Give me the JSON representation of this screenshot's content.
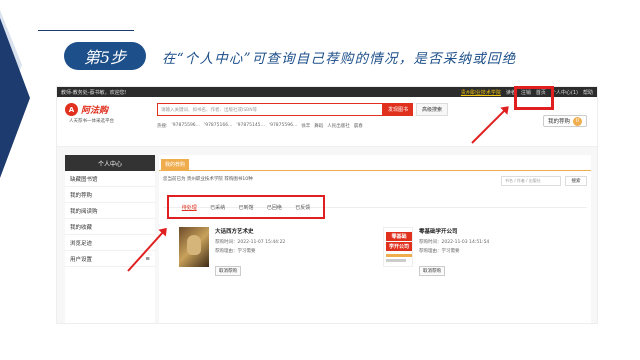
{
  "slide": {
    "step_label": "第5步",
    "step_desc": "在“个人中心”可查询自己荐购的情况，是否采纳或回绝"
  },
  "topbar": {
    "welcome": "教师-教务处-蔡书敏，欢迎您!",
    "school_link": "贵州职业技术学院",
    "items": [
      "读者",
      "注销",
      "首页",
      "个人中心(1)",
      "帮助"
    ]
  },
  "header": {
    "brand": "阿法购",
    "brand_mark": "A",
    "slogan": "人天荐书一体采选平台",
    "search_placeholder": "请输入关键词、如书名、作者、出版社或ISBN等",
    "search_button": "发现图书",
    "advanced_button": "高级搜索",
    "hot_label": "热搜:",
    "hot_terms": [
      "'97875596...",
      "'97875166...",
      "'97875145...",
      "'97875596...",
      "徐丰",
      "舞蹈",
      "人民出版社",
      "晨春"
    ],
    "my_purchase_label": "我的荐购",
    "my_purchase_count": "0"
  },
  "sidebar": {
    "title": "个人中心",
    "items": [
      {
        "label": "缺藏图书馆",
        "arrow": ""
      },
      {
        "label": "我的荐购",
        "arrow": ""
      },
      {
        "label": "我的阅读购",
        "arrow": ""
      },
      {
        "label": "我的收藏",
        "arrow": ""
      },
      {
        "label": "浏览足迹",
        "arrow": ""
      },
      {
        "label": "用户设置",
        "arrow": "≡"
      }
    ]
  },
  "main": {
    "tab": "我的荐购",
    "info": "您当前已为 贵州职业技术学院 荐购图书10种",
    "search_placeholder": "书名 / 作者 / 出版社",
    "search_button": "搜索",
    "status_tabs": [
      "待处理",
      "已采纳",
      "已到馆",
      "已回绝",
      "已反馈"
    ],
    "books": [
      {
        "title": "大话西方艺术史",
        "time": "荐购时间：2022-11-07 15:44:22",
        "reason": "荐购理由：学习需要",
        "cancel": "取消荐购"
      },
      {
        "title": "零基础学开公司",
        "time": "荐购时间：2022-11-03 14:51:54",
        "reason": "荐购理由：学习需要",
        "cancel": "取消荐购",
        "cover_text_1": "零基础",
        "cover_text_2": "学开公司"
      }
    ]
  },
  "colors": {
    "accent_red": "#e0301e",
    "highlight_red": "#e02020",
    "navy": "#1d4f8a",
    "orange": "#f0ad4e"
  }
}
